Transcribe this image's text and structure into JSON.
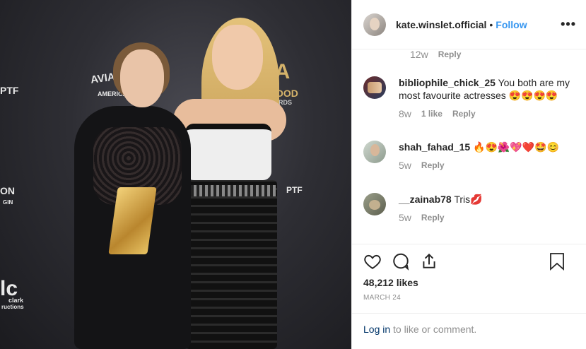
{
  "post": {
    "username": "kate.winslet.official",
    "separator": "•",
    "follow_label": "Follow",
    "more_icon": "more-options-icon",
    "more_text": "•••"
  },
  "photo": {
    "logos": [
      "AVIAT",
      "AMERICA",
      "PTF",
      "FA",
      "OOD",
      "RDS",
      "ON",
      "GIN",
      "PTF",
      "lc",
      "clark",
      "ructions"
    ]
  },
  "comments": [
    {
      "user": "",
      "text": "",
      "time": "12w",
      "likes": "",
      "reply": "Reply"
    },
    {
      "user": "bibliophile_chick_25",
      "text": "You both are my most favourite actresses 😍😍😍😍",
      "time": "8w",
      "likes": "1 like",
      "reply": "Reply"
    },
    {
      "user": "shah_fahad_15",
      "text": "🔥😍🌺💖❤️🤩😊",
      "time": "5w",
      "likes": "",
      "reply": "Reply"
    },
    {
      "user": "__zainab78",
      "text": "Tris💋",
      "time": "5w",
      "likes": "",
      "reply": "Reply"
    }
  ],
  "actions": {
    "like_icon": "heart-icon",
    "comment_icon": "comment-icon",
    "share_icon": "share-icon",
    "save_icon": "bookmark-icon",
    "likes_text": "48,212 likes",
    "date": "MARCH 24"
  },
  "login": {
    "link": "Log in",
    "rest": " to like or comment."
  },
  "colors": {
    "accent": "#3897f0",
    "muted": "#8e8e8e",
    "text": "#262626",
    "link": "#003569"
  }
}
